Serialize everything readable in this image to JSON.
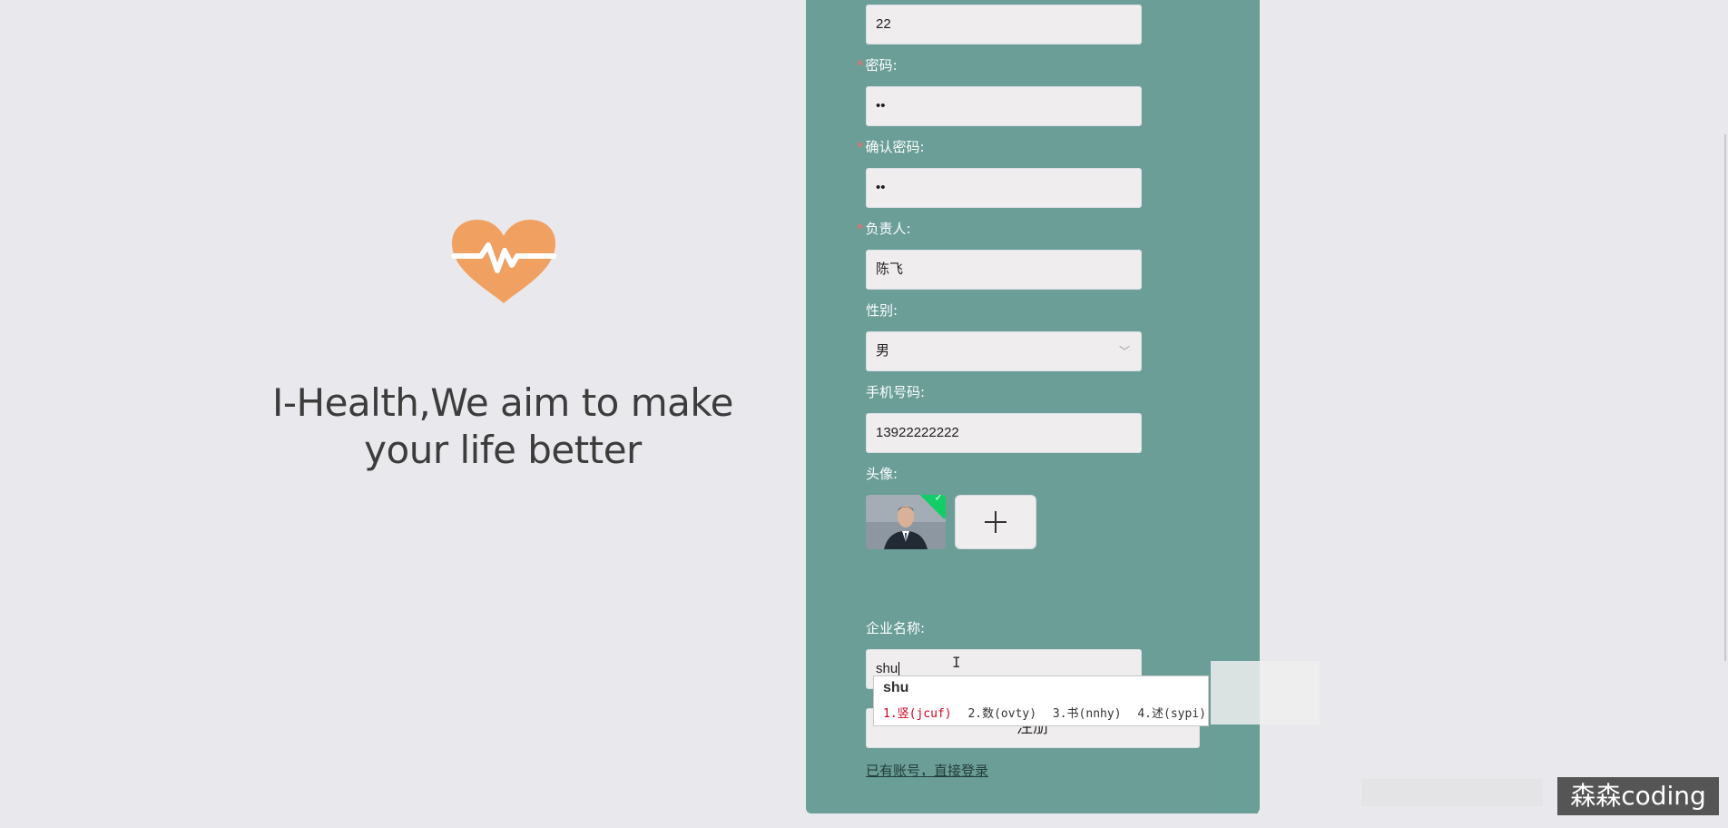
{
  "branding": {
    "slogan_line1": "I-Health,We aim to make",
    "slogan_line2": "your life better",
    "logo_icon": "heart-pulse-icon",
    "logo_color": "#f0a060"
  },
  "form": {
    "top_field_value": "22",
    "password": {
      "label": "密码:",
      "value": "••"
    },
    "confirm_password": {
      "label": "确认密码:",
      "value": "••"
    },
    "contact_person": {
      "label": "负责人:",
      "value": "陈飞"
    },
    "gender": {
      "label": "性别:",
      "selected": "男"
    },
    "phone": {
      "label": "手机号码:",
      "value": "13922222222"
    },
    "avatar": {
      "label": "头像:",
      "upload_icon": "plus-icon"
    },
    "company_name": {
      "label": "企业名称:",
      "value": "shu"
    },
    "submit_label": "注册",
    "login_link": "已有账号，直接登录"
  },
  "ime": {
    "composition": "shu",
    "candidates": [
      "1.竖(jcuf)",
      "2.数(ovty)",
      "3.书(nnhy)",
      "4.述(sypi)"
    ]
  },
  "watermark": "森森coding",
  "colors": {
    "panel": "#6a9e97",
    "background": "#e9e8ec",
    "required": "#f56c6c"
  }
}
